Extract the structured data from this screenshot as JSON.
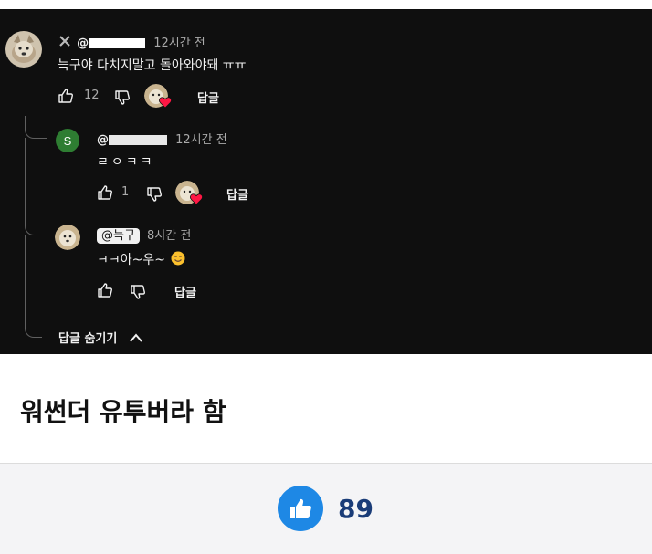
{
  "comment": {
    "handle_prefix": "@",
    "time": "12시간 전",
    "text": "늑구야 다치지말고 돌아와야돼 ㅠㅠ",
    "likes": "12",
    "reply_label": "답글"
  },
  "replies": [
    {
      "avatar_letter": "S",
      "handle_prefix": "@",
      "time": "12시간 전",
      "text": "ㄹㅇㅋㅋ",
      "likes": "1",
      "reply_label": "답글"
    },
    {
      "mention": "@늑구",
      "time": "8시간 전",
      "text": "ㅋㅋ아~우~",
      "reply_label": "답글"
    }
  ],
  "hide_replies_label": "답글 숨기기",
  "caption": "워썬더 유투버라 함",
  "post_likes": "89",
  "colors": {
    "dark_bg": "#0f0f0f",
    "like_blue": "#1e88e5",
    "count_navy": "#1a3c78",
    "avatar_green": "#2e7d32"
  }
}
